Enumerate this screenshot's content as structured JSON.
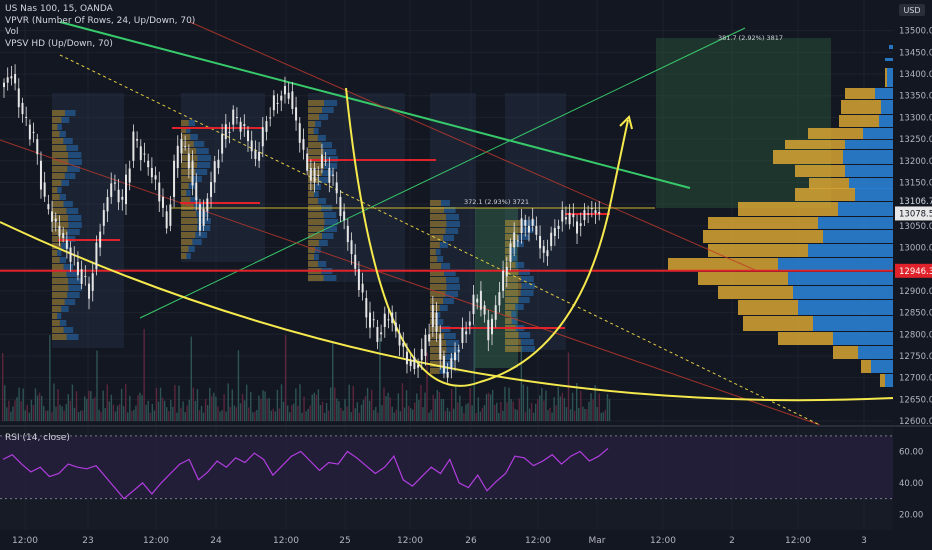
{
  "header": {
    "symbol_line": "US Nas 100, 15, OANDA",
    "indicators": [
      "VPVR (Number Of Rows, 24, Up/Down, 70)",
      "Vol",
      "VPSV HD (Up/Down, 70)"
    ],
    "rsi_label": "RSI (14, close)"
  },
  "colors": {
    "background": "#131722",
    "grid": "#1e222d",
    "candle": "#e6e6e6",
    "vp_up": "#2a7fd1",
    "vp_down": "#d8a431",
    "red_line": "#e0222a",
    "yellow_line": "#f5e94d",
    "green_line": "#3fd86a",
    "rsi_line": "#b13de0",
    "rsi_bg": "#2a1f3f"
  },
  "chart_data": [
    {
      "type": "candlestick",
      "title": "US Nas 100, 15, OANDA",
      "currency": "USD",
      "ylim": [
        12600,
        13520
      ],
      "y_ticks": [
        "13500.0",
        "13450.0",
        "13400.0",
        "13350.0",
        "13300.0",
        "13250.0",
        "13200.0",
        "13150.0",
        "13100.0",
        "13050.0",
        "13000.0",
        "12950.0",
        "12900.0",
        "12850.0",
        "12800.0",
        "12750.0",
        "12700.0",
        "12650.0",
        "12600.0"
      ],
      "x_ticks": [
        "12:00",
        "23",
        "12:00",
        "24",
        "12:00",
        "25",
        "12:00",
        "26",
        "12:00",
        "Mar",
        "12:00",
        "2",
        "12:00",
        "3"
      ],
      "price_tags": [
        {
          "label": "13106.7",
          "value": 13106.7,
          "style": "neutral"
        },
        {
          "label": "13078.5",
          "value": 13078.5,
          "style": "current"
        },
        {
          "label": "12946.3",
          "value": 12946.3,
          "style": "red"
        }
      ],
      "annotations": [
        {
          "text": "372.1 (2.93%) 3721",
          "value": 13100
        },
        {
          "text": "381.7 (2.92%) 3817",
          "value": 13478
        }
      ],
      "close_path": [
        13370,
        13400,
        13300,
        13250,
        13100,
        13050,
        13000,
        12950,
        12900,
        13050,
        13150,
        13100,
        13250,
        13200,
        13150,
        13050,
        13250,
        13200,
        13050,
        13150,
        13250,
        13300,
        13270,
        13200,
        13300,
        13350,
        13360,
        13250,
        13150,
        13200,
        13150,
        13050,
        12950,
        12850,
        12800,
        12850,
        12780,
        12720,
        12750,
        12850,
        12700,
        12760,
        12820,
        12900,
        12800,
        12900,
        13000,
        13050,
        13050,
        12980,
        13050,
        13080,
        13050,
        13090,
        13078
      ]
    },
    {
      "type": "line",
      "title": "RSI (14, close)",
      "ylim": [
        10,
        75
      ],
      "y_ticks": [
        "60.00",
        "40.00",
        "20.00"
      ],
      "bands": [
        70,
        30
      ],
      "values": [
        55,
        58,
        52,
        47,
        50,
        44,
        46,
        52,
        50,
        49,
        51,
        44,
        37,
        30,
        35,
        40,
        33,
        40,
        46,
        52,
        55,
        42,
        47,
        54,
        50,
        56,
        53,
        59,
        55,
        45,
        51,
        57,
        60,
        54,
        48,
        53,
        52,
        60,
        56,
        51,
        46,
        50,
        57,
        42,
        38,
        44,
        50,
        46,
        55,
        40,
        37,
        45,
        35,
        41,
        46,
        57,
        56,
        51,
        54,
        58,
        52,
        57,
        60,
        54,
        57,
        62
      ]
    }
  ]
}
